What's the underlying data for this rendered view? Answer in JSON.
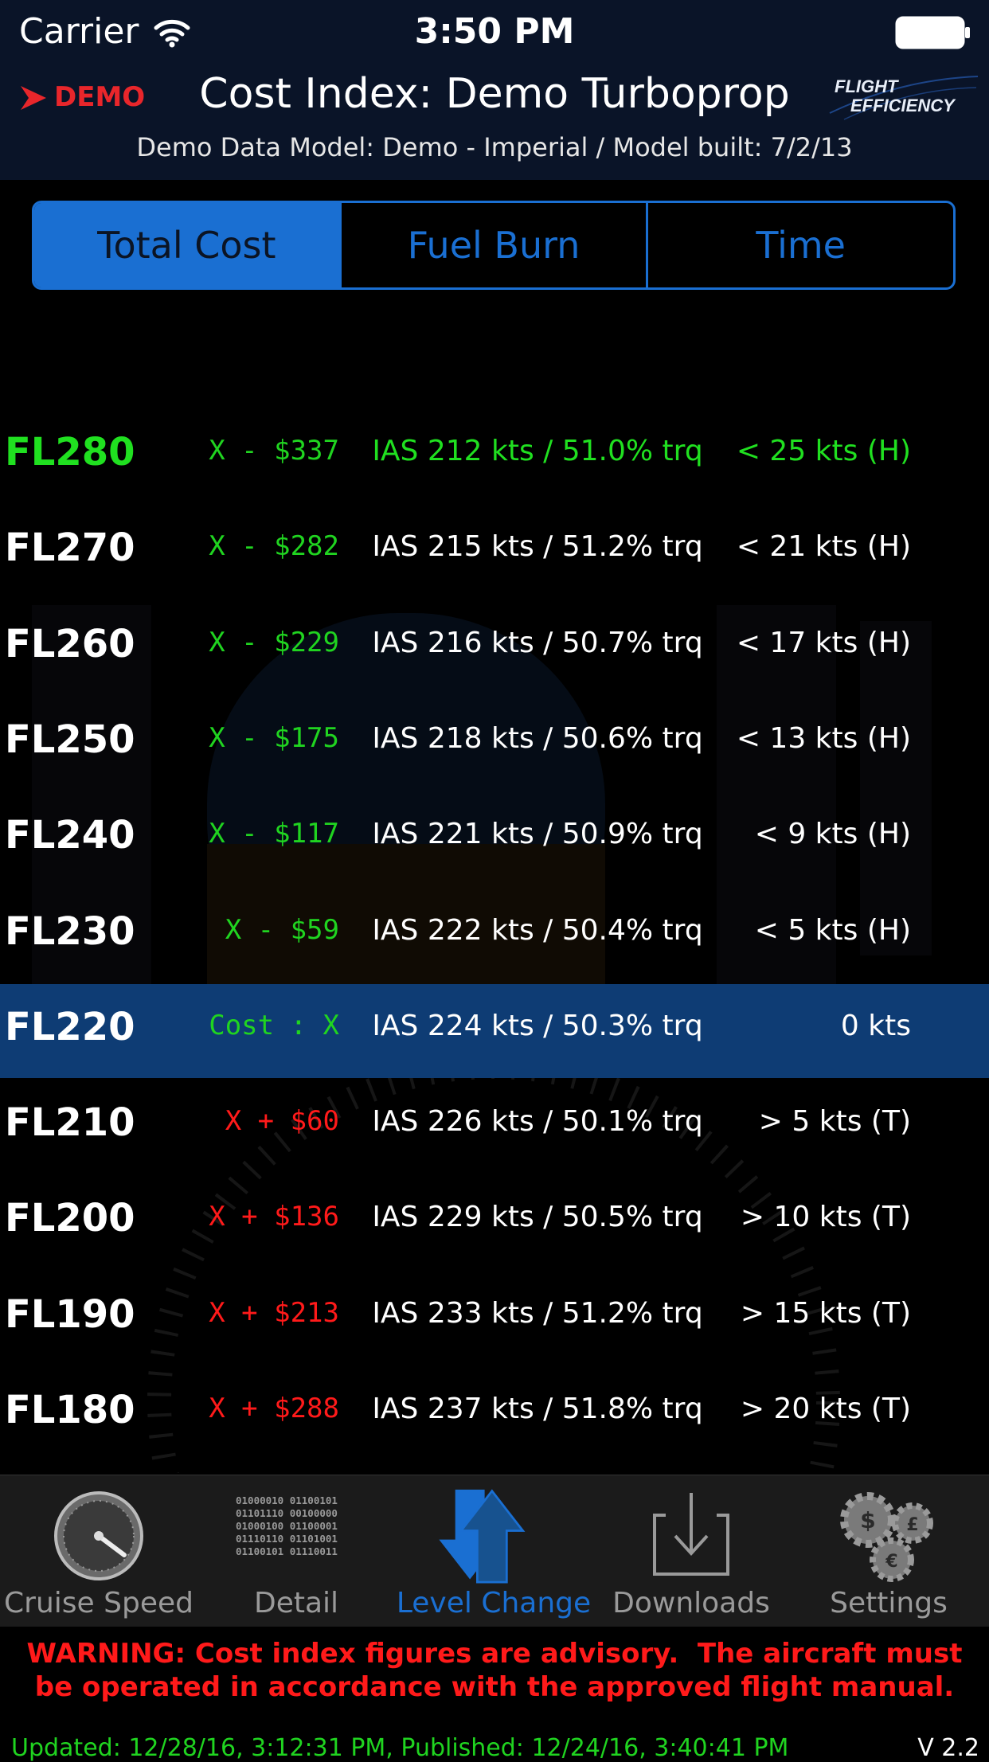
{
  "status_bar": {
    "carrier": "Carrier",
    "time": "3:50 PM"
  },
  "header": {
    "demo_label": "DEMO",
    "title": "Cost Index: Demo Turboprop",
    "subtitle": "Demo Data Model: Demo - Imperial / Model built: 7/2/13",
    "brand_line1": "FLIGHT",
    "brand_line2": "EFFICIENCY"
  },
  "segments": [
    {
      "label": "Total Cost",
      "active": true
    },
    {
      "label": "Fuel Burn",
      "active": false
    },
    {
      "label": "Time",
      "active": false
    }
  ],
  "rows": [
    {
      "fl": "FL280",
      "delta": "X - $337",
      "ias": "IAS 212 kts / 51.0% trq",
      "wind": "< 25 kts (H)"
    },
    {
      "fl": "FL270",
      "delta": "X - $282",
      "ias": "IAS 215 kts / 51.2% trq",
      "wind": "< 21 kts (H)"
    },
    {
      "fl": "FL260",
      "delta": "X - $229",
      "ias": "IAS 216 kts / 50.7% trq",
      "wind": "< 17 kts (H)"
    },
    {
      "fl": "FL250",
      "delta": "X - $175",
      "ias": "IAS 218 kts / 50.6% trq",
      "wind": "< 13 kts (H)"
    },
    {
      "fl": "FL240",
      "delta": "X - $117",
      "ias": "IAS 221 kts / 50.9% trq",
      "wind": "< 9 kts (H)"
    },
    {
      "fl": "FL230",
      "delta": "X - $59",
      "ias": "IAS 222 kts / 50.4% trq",
      "wind": "< 5 kts (H)"
    },
    {
      "fl": "FL220",
      "delta": "Cost : X",
      "ias": "IAS 224 kts / 50.3% trq",
      "wind": "0 kts"
    },
    {
      "fl": "FL210",
      "delta": "X + $60",
      "ias": "IAS 226 kts / 50.1% trq",
      "wind": "> 5 kts (T)"
    },
    {
      "fl": "FL200",
      "delta": "X + $136",
      "ias": "IAS 229 kts / 50.5% trq",
      "wind": "> 10 kts (T)"
    },
    {
      "fl": "FL190",
      "delta": "X + $213",
      "ias": "IAS 233 kts / 51.2% trq",
      "wind": "> 15 kts (T)"
    },
    {
      "fl": "FL180",
      "delta": "X + $288",
      "ias": "IAS 237 kts / 51.8% trq",
      "wind": "> 20 kts (T)"
    }
  ],
  "colors": {
    "accent": "#1a6fd2",
    "cheaper": "#20d420",
    "costlier": "#ff1a1a",
    "selected_row": "#0e3c74",
    "best_level": "#20e020"
  },
  "tabs": [
    {
      "label": "Cruise Speed",
      "icon": "speed-gauge-icon"
    },
    {
      "label": "Detail",
      "icon": "binary-data-icon"
    },
    {
      "label": "Level Change",
      "icon": "level-change-arrows-icon"
    },
    {
      "label": "Downloads",
      "icon": "download-tray-icon"
    },
    {
      "label": "Settings",
      "icon": "currency-gears-icon"
    }
  ],
  "detail_icon_lines": [
    "01000010 01100101",
    "01101110 00100000",
    "01000100 01100001",
    "01110110 01101001",
    "01100101 01110011"
  ],
  "footer": {
    "warning_line1": "WARNING: Cost index figures are advisory.  The aircraft must",
    "warning_line2": "be operated in accordance with the approved flight manual.",
    "updated": "Updated: 12/28/16, 3:12:31 PM, Published: 12/24/16, 3:40:41 PM",
    "version": "V 2.2"
  }
}
